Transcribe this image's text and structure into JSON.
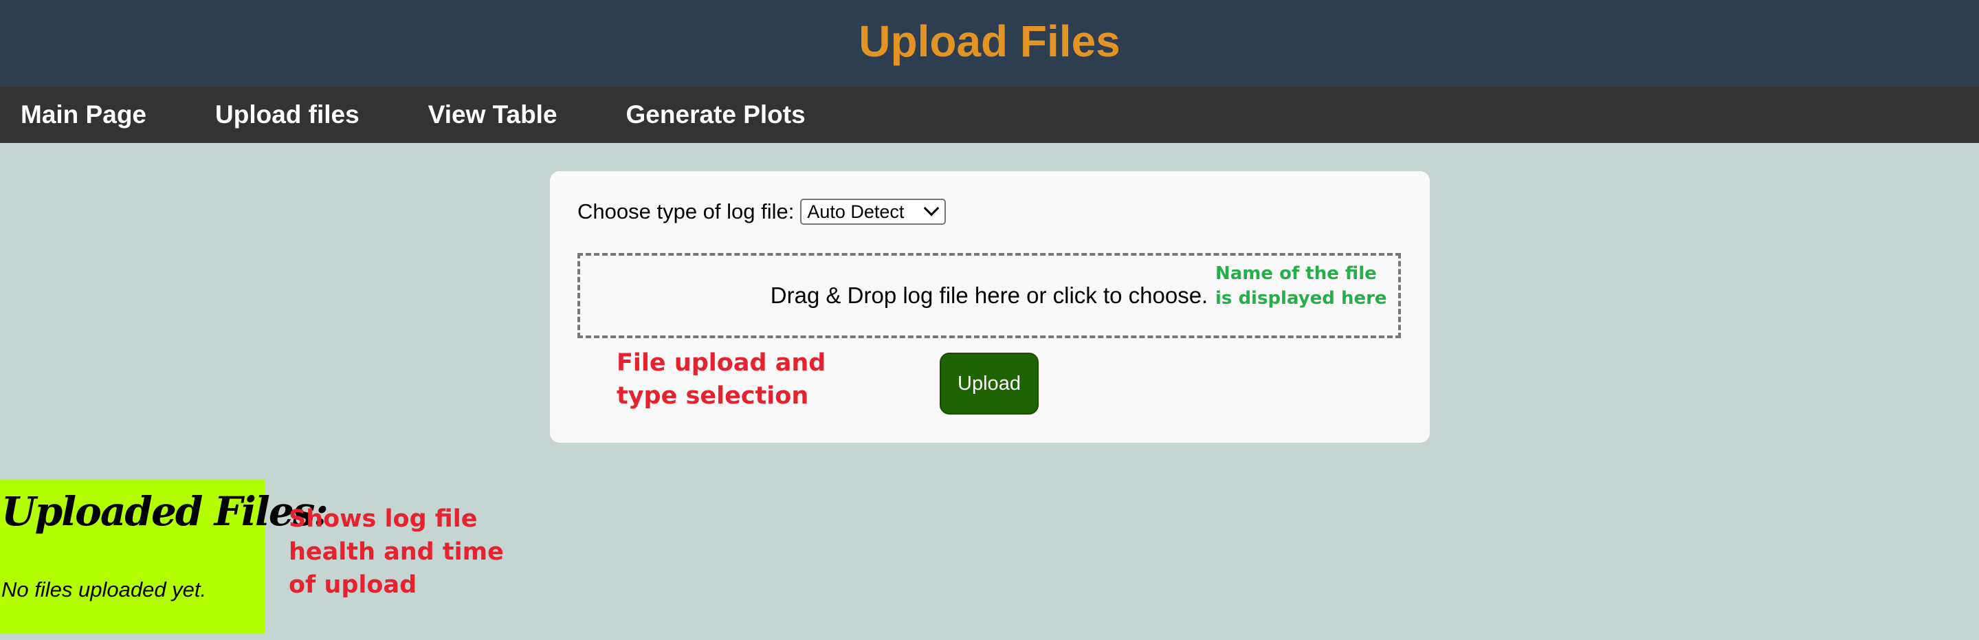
{
  "header": {
    "title": "Upload Files",
    "title_color": "#e39423",
    "bg_color": "#2c3e50"
  },
  "nav": {
    "items": [
      {
        "label": "Main Page"
      },
      {
        "label": "Upload files"
      },
      {
        "label": "View Table"
      },
      {
        "label": "Generate Plots"
      }
    ]
  },
  "upload_form": {
    "type_label": "Choose type of log file:",
    "selected_type": "Auto Detect",
    "drop_text": "Drag & Drop log file here or click to choose.",
    "upload_button": "Upload"
  },
  "annotations": {
    "file_name_line1": "Name of the file",
    "file_name_line2": "is displayed here",
    "upload_line1": "File upload and",
    "upload_line2": "type selection",
    "uploaded_line1": "Shows log file",
    "uploaded_line2": "health and time",
    "uploaded_line3": "of upload"
  },
  "uploaded": {
    "title": "Uploaded Files:",
    "empty_text": "No files uploaded yet.",
    "bg_color": "#b3ff00"
  }
}
